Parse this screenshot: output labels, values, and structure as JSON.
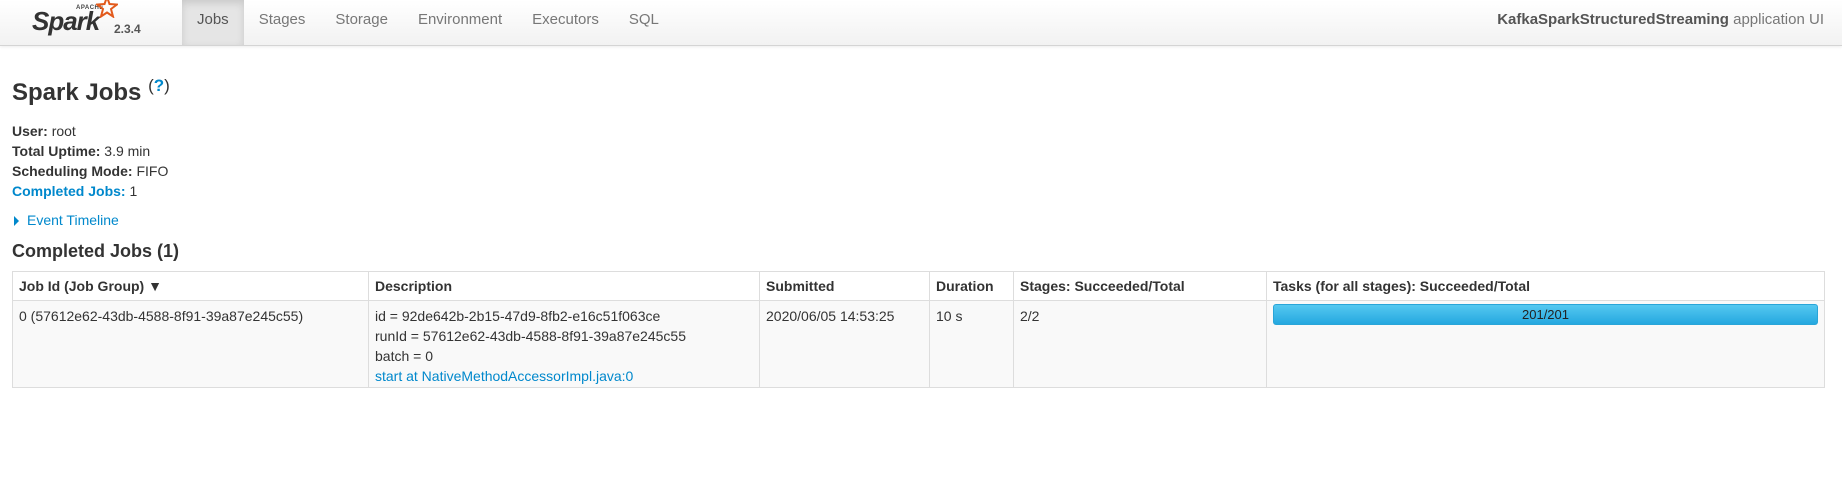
{
  "brand": {
    "apache": "APACHE",
    "spark": "Spark",
    "version": "2.3.4"
  },
  "nav": {
    "tabs": [
      {
        "label": "Jobs",
        "active": true
      },
      {
        "label": "Stages"
      },
      {
        "label": "Storage"
      },
      {
        "label": "Environment"
      },
      {
        "label": "Executors"
      },
      {
        "label": "SQL"
      }
    ],
    "app_name": "KafkaSparkStructuredStreaming",
    "app_suffix": "application UI"
  },
  "page": {
    "title": "Spark Jobs",
    "help": "?",
    "user_label": "User:",
    "user": "root",
    "uptime_label": "Total Uptime:",
    "uptime": "3.9 min",
    "scheduling_label": "Scheduling Mode:",
    "scheduling": "FIFO",
    "completed_label": "Completed Jobs:",
    "completed": "1",
    "event_timeline": "Event Timeline",
    "section_title": "Completed Jobs (1)"
  },
  "table": {
    "headers": [
      "Job Id (Job Group) ▼",
      "Description",
      "Submitted",
      "Duration",
      "Stages: Succeeded/Total",
      "Tasks (for all stages): Succeeded/Total"
    ],
    "rows": [
      {
        "job_id": "0 (57612e62-43db-4588-8f91-39a87e245c55)",
        "desc_lines": [
          "id = 92de642b-2b15-47d9-8fb2-e16c51f063ce",
          "runId = 57612e62-43db-4588-8f91-39a87e245c55",
          "batch = 0"
        ],
        "desc_link": "start at NativeMethodAccessorImpl.java:0",
        "submitted": "2020/06/05 14:53:25",
        "duration": "10 s",
        "stages": "2/2",
        "tasks": "201/201",
        "tasks_fraction": 1.0
      }
    ]
  },
  "colors": {
    "link": "#0088cc",
    "progress": "#25a8e0"
  }
}
